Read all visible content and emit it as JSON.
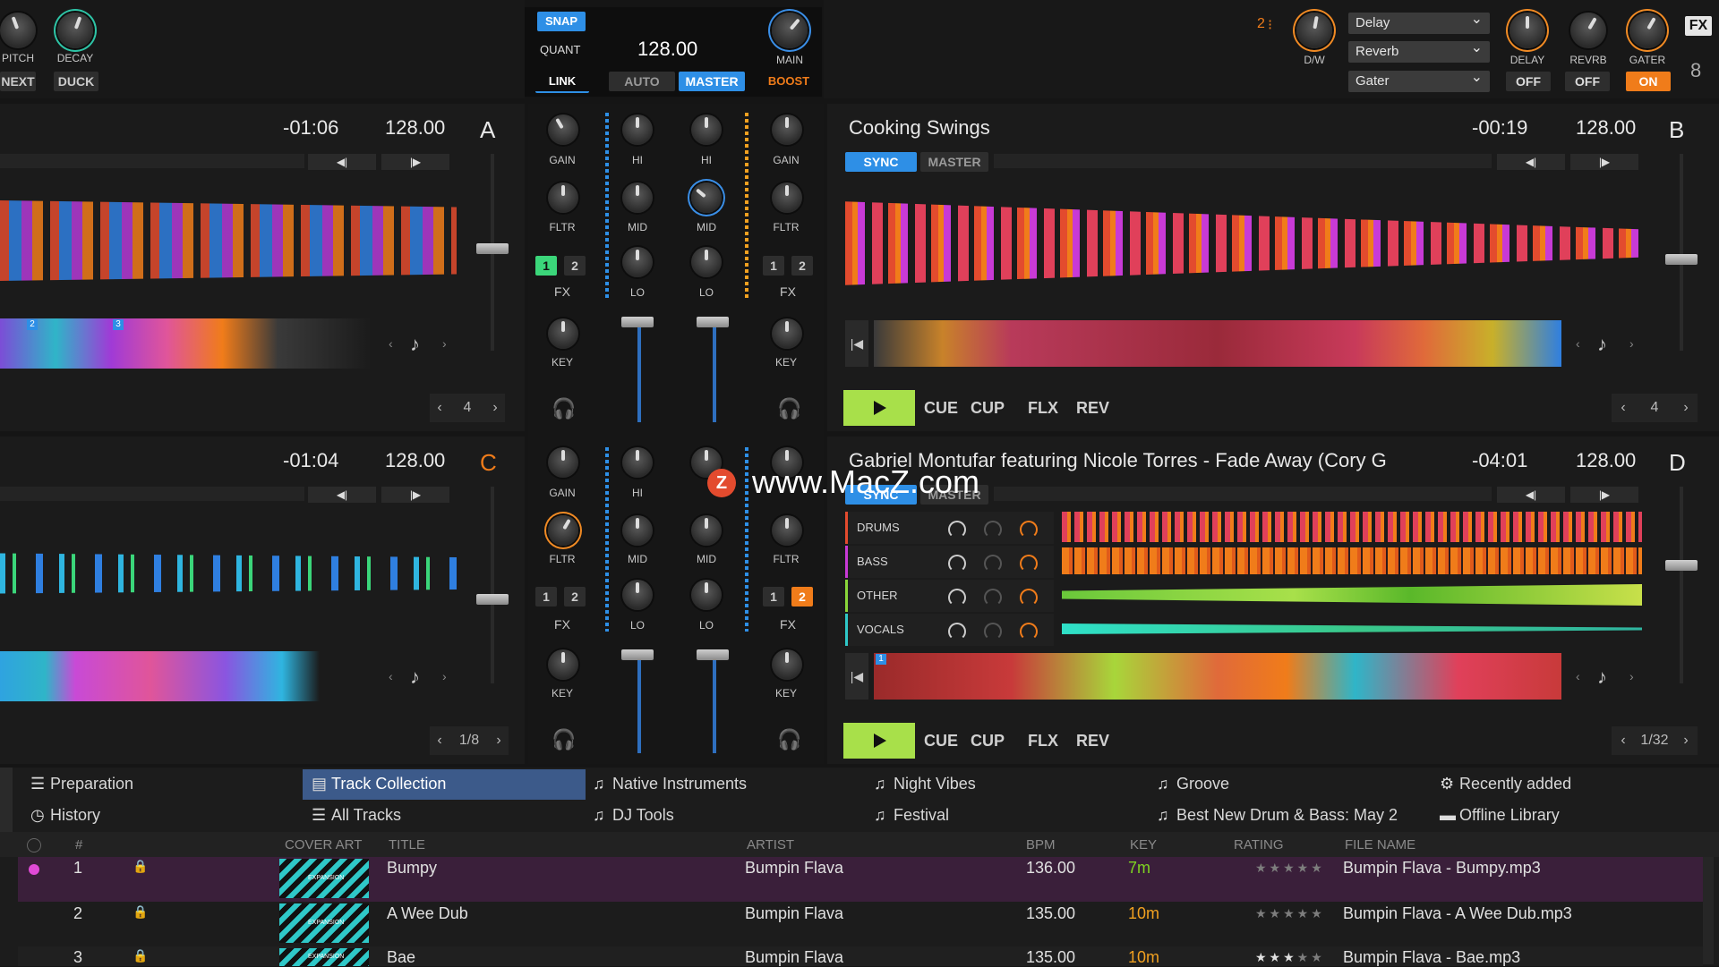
{
  "top_left": {
    "knobs": [
      {
        "label": "PITCH"
      },
      {
        "label": "DECAY"
      }
    ],
    "buttons": [
      {
        "label": "NEXT"
      },
      {
        "label": "DUCK"
      }
    ]
  },
  "center_top": {
    "snap": "SNAP",
    "quant": "QUANT",
    "bpm": "128.00",
    "link": "LINK",
    "auto": "AUTO",
    "master": "MASTER",
    "main": "MAIN",
    "boost": "BOOST"
  },
  "fx_top": {
    "unit": "2",
    "dw": "D/W",
    "selects": [
      "Delay",
      "Reverb",
      "Gater"
    ],
    "knobs": [
      "DELAY",
      "REVRB",
      "GATER"
    ],
    "states": [
      "OFF",
      "OFF",
      "ON"
    ],
    "fx": "FX"
  },
  "deckA": {
    "time": "-01:06",
    "bpm": "128.00",
    "letter": "A",
    "loop": "4",
    "cues": [
      "2",
      "3"
    ]
  },
  "deckC": {
    "time": "-01:04",
    "bpm": "128.00",
    "letter": "C",
    "loop": "1/8"
  },
  "deckB": {
    "title": "Cooking Swings",
    "time": "-00:19",
    "bpm": "128.00",
    "letter": "B",
    "sync": "SYNC",
    "master": "MASTER",
    "loop": "4",
    "transport": [
      "CUE",
      "CUP",
      "FLX",
      "REV"
    ]
  },
  "deckD": {
    "title": "Gabriel Montufar featuring Nicole Torres - Fade Away (Cory G",
    "time": "-04:01",
    "bpm": "128.00",
    "letter": "D",
    "sync": "SYNC",
    "master": "MASTER",
    "loop": "1/32",
    "stems": [
      "DRUMS",
      "BASS",
      "OTHER",
      "VOCALS"
    ],
    "cue": "1",
    "transport": [
      "CUE",
      "CUP",
      "FLX",
      "REV"
    ]
  },
  "mixer": {
    "gain": "GAIN",
    "hi": "HI",
    "mid": "MID",
    "lo": "LO",
    "fltr": "FLTR",
    "key": "KEY",
    "fx": "FX",
    "fx1": "1",
    "fx2": "2"
  },
  "watermark": "www.MacZ.com",
  "watermark_mark": "Z",
  "browser": {
    "tabs": [
      {
        "label": "Preparation",
        "icon": "list-icon"
      },
      {
        "label": "History",
        "icon": "clock-icon"
      },
      {
        "label": "Track Collection",
        "icon": "collection-icon"
      },
      {
        "label": "All Tracks",
        "icon": "list-icon"
      },
      {
        "label": "Native Instruments",
        "icon": "playlist-icon"
      },
      {
        "label": "DJ Tools",
        "icon": "playlist-icon"
      },
      {
        "label": "Night Vibes",
        "icon": "playlist-icon"
      },
      {
        "label": "Festival",
        "icon": "playlist-icon"
      },
      {
        "label": "Groove",
        "icon": "playlist-icon"
      },
      {
        "label": "Best New Drum & Bass: May 2",
        "icon": "playlist-icon"
      },
      {
        "label": "Recently added",
        "icon": "gear-icon"
      },
      {
        "label": "Offline Library",
        "icon": "folder-icon"
      }
    ],
    "columns": [
      "#",
      "COVER ART",
      "TITLE",
      "ARTIST",
      "BPM",
      "KEY",
      "RATING",
      "FILE NAME"
    ],
    "rows": [
      {
        "num": "1",
        "title": "Bumpy",
        "artist": "Bumpin Flava",
        "bpm": "136.00",
        "key": "7m",
        "rating": 0,
        "file": "Bumpin Flava - Bumpy.mp3",
        "cover_text": "EXPANSION"
      },
      {
        "num": "2",
        "title": "A Wee Dub",
        "artist": "Bumpin Flava",
        "bpm": "135.00",
        "key": "10m",
        "rating": 0,
        "file": "Bumpin Flava - A Wee Dub.mp3",
        "cover_text": "EXPANSION"
      },
      {
        "num": "3",
        "title": "Bae",
        "artist": "Bumpin Flava",
        "bpm": "135.00",
        "key": "10m",
        "rating": 3,
        "file": "Bumpin Flava - Bae.mp3",
        "cover_text": "EXPANSION"
      }
    ]
  },
  "colors": {
    "accent_blue": "#2e8fe6",
    "accent_orange": "#f07c1a",
    "play_green": "#a8e04a",
    "key_green": "#7ed321",
    "key_orange": "#f0a020",
    "selected_row": "#3a1f3a"
  }
}
